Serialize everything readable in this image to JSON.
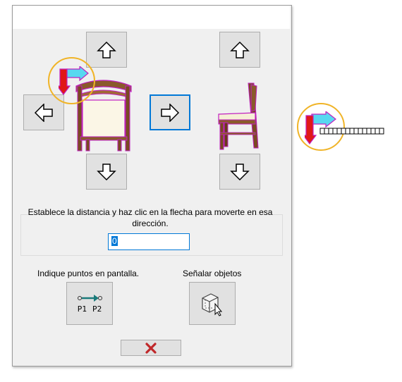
{
  "dialog": {
    "instruction_text": "Establece la distancia y haz clic en la flecha para moverte en esa dirección.",
    "distance_input": {
      "value": "0"
    },
    "points_label": "Indique puntos en pantalla.",
    "points_button": {
      "p1_label": "P1",
      "p2_label": "P2"
    },
    "objects_label": "Señalar objetos",
    "close_button_icon": "red-x-icon"
  },
  "colors": {
    "accent": "#0078d7",
    "highlight_circle": "#f0b428",
    "axis_red": "#e01818",
    "axis_cyan": "#58d8f0",
    "selection_magenta": "#c020c0",
    "chair_wood": "#8a5a2b",
    "close_x": "#c0282a"
  }
}
